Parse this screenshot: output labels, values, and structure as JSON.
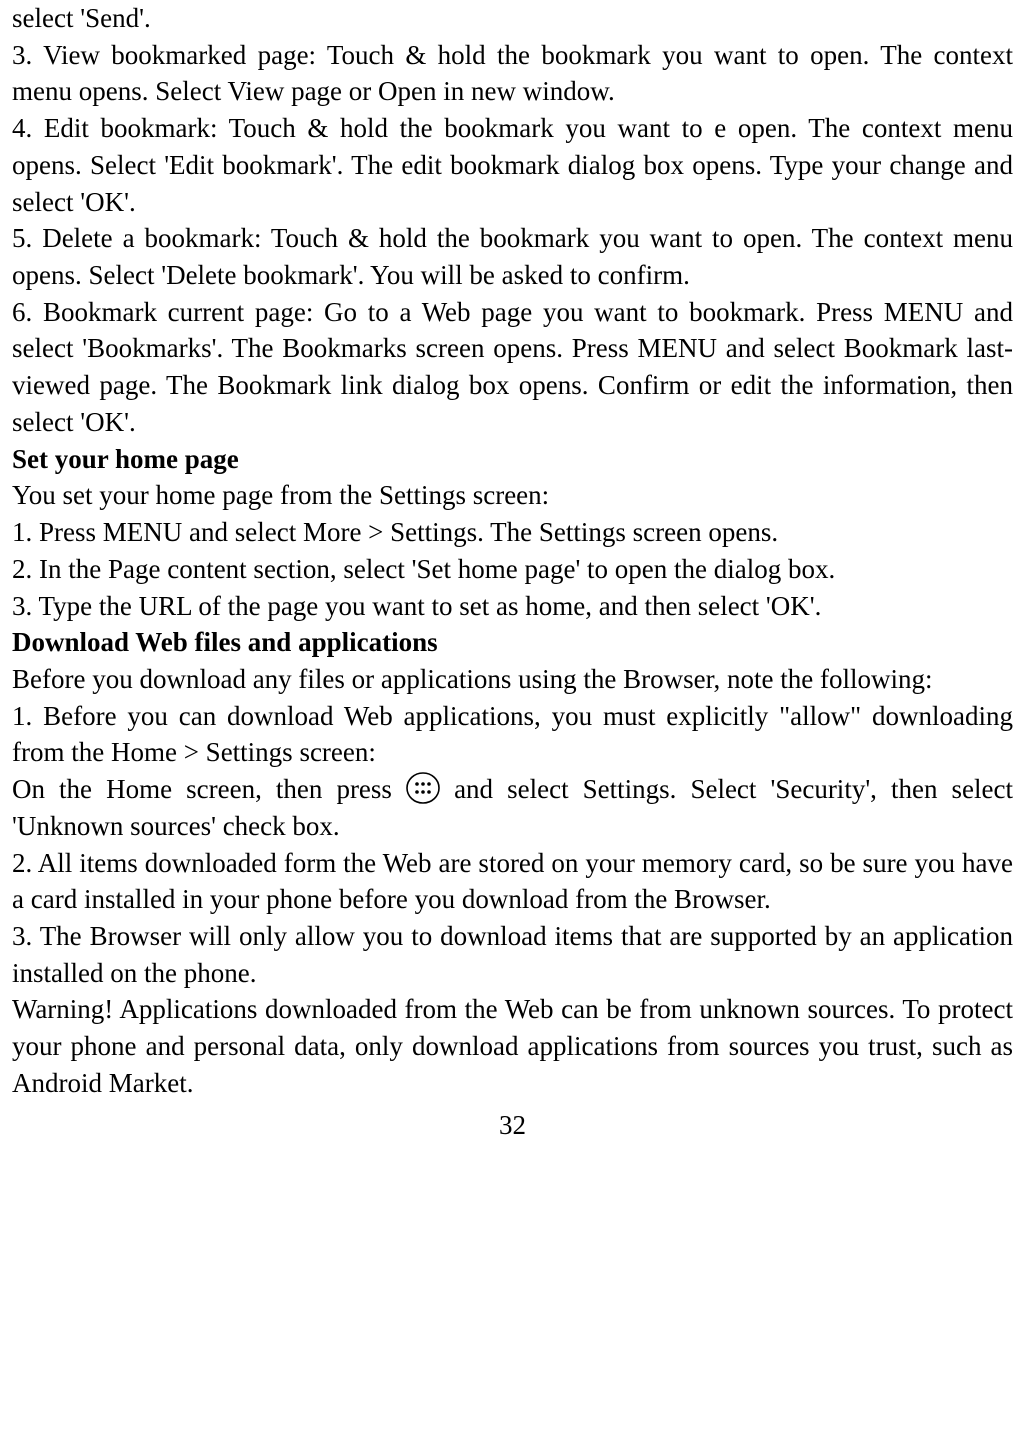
{
  "lines": {
    "l0": "select 'Send'.",
    "l1": "3. View bookmarked page: Touch & hold the bookmark you want to open. The context menu opens. Select View page or Open in new window.",
    "l2": "4. Edit bookmark: Touch & hold the bookmark you want to e open. The context menu opens. Select 'Edit bookmark'. The edit bookmark dialog box opens. Type your change and select 'OK'.",
    "l3": "5. Delete a bookmark: Touch & hold the bookmark you want to open. The context menu opens. Select 'Delete bookmark'. You will be asked to confirm.",
    "l4": "6. Bookmark current page: Go to a Web page you want to bookmark. Press MENU and select 'Bookmarks'. The Bookmarks screen opens. Press MENU and select Bookmark last-viewed page. The Bookmark link dialog box opens. Confirm or edit the information, then select 'OK'.",
    "h1": "Set your home page",
    "l5": "You set your home page from the Settings screen:",
    "l6": "1. Press MENU and select More > Settings. The Settings screen opens.",
    "l7": "2. In the Page content section, select 'Set home page' to open the dialog box.",
    "l8": "3. Type the URL of the page you want to set as home, and then select 'OK'.",
    "h2": "Download Web files and applications",
    "l9": "Before you download any files or applications using the Browser, note the following:",
    "l10": "1. Before you can download Web applications, you must explicitly \"allow\" downloading from the Home > Settings screen:",
    "l11a": "On the Home screen, then press ",
    "l11b": " and select Settings. Select 'Security', then select 'Unknown sources' check box.",
    "l12": "2. All items downloaded form the Web are stored on your memory card, so be sure you have a card installed in your phone before you download from the Browser.",
    "l13": "3. The Browser will only allow you to download items that are supported by an application installed on the phone.",
    "l14": "Warning! Applications downloaded from the Web can be from unknown sources. To protect your phone and personal data, only download applications from sources you trust, such as Android Market.",
    "page_number": "32"
  }
}
